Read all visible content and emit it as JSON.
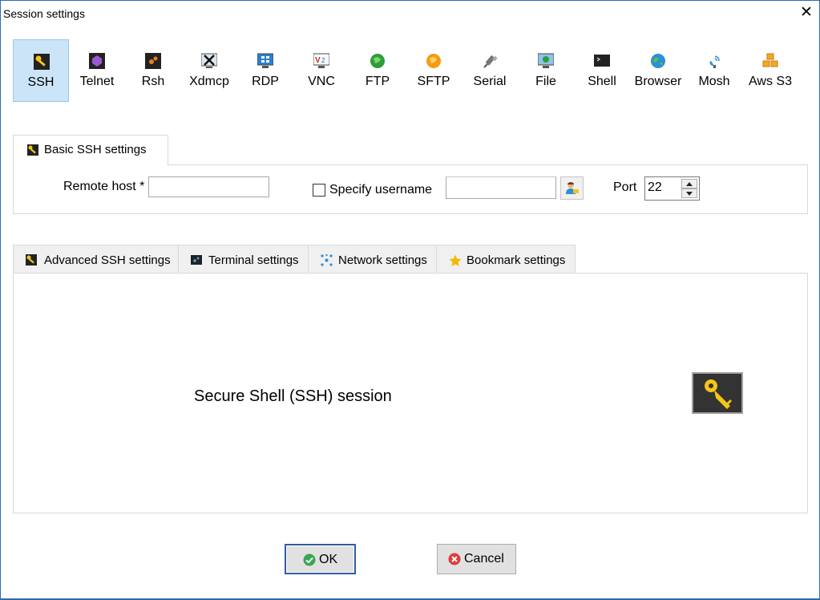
{
  "window": {
    "title": "Session settings",
    "close_symbol": "✕"
  },
  "session_types": [
    {
      "label": "SSH",
      "icon": "ssh-key-icon",
      "selected": true
    },
    {
      "label": "Telnet",
      "icon": "telnet-icon"
    },
    {
      "label": "Rsh",
      "icon": "rsh-icon"
    },
    {
      "label": "Xdmcp",
      "icon": "xdmcp-icon"
    },
    {
      "label": "RDP",
      "icon": "rdp-icon"
    },
    {
      "label": "VNC",
      "icon": "vnc-icon"
    },
    {
      "label": "FTP",
      "icon": "ftp-icon"
    },
    {
      "label": "SFTP",
      "icon": "sftp-icon"
    },
    {
      "label": "Serial",
      "icon": "serial-icon"
    },
    {
      "label": "File",
      "icon": "file-icon"
    },
    {
      "label": "Shell",
      "icon": "shell-icon"
    },
    {
      "label": "Browser",
      "icon": "browser-icon"
    },
    {
      "label": "Mosh",
      "icon": "mosh-icon"
    },
    {
      "label": "Aws S3",
      "icon": "aws-s3-icon"
    }
  ],
  "basic": {
    "tab_label": "Basic SSH settings",
    "remote_host_label": "Remote host *",
    "remote_host_value": "",
    "specify_username_label": "Specify username",
    "specify_username_checked": false,
    "username_value": "",
    "port_label": "Port",
    "port_value": "22"
  },
  "advanced_tabs": [
    {
      "label": "Advanced SSH settings",
      "icon": "ssh-key-icon"
    },
    {
      "label": "Terminal settings",
      "icon": "terminal-icon"
    },
    {
      "label": "Network settings",
      "icon": "network-icon"
    },
    {
      "label": "Bookmark settings",
      "icon": "star-icon"
    }
  ],
  "panel": {
    "description": "Secure Shell (SSH) session",
    "icon": "key-icon"
  },
  "buttons": {
    "ok_label": "OK",
    "cancel_label": "Cancel"
  },
  "colors": {
    "selected_bg": "#cce4f7",
    "ok_border": "#2d5ea3",
    "key_yellow": "#f5c518"
  }
}
